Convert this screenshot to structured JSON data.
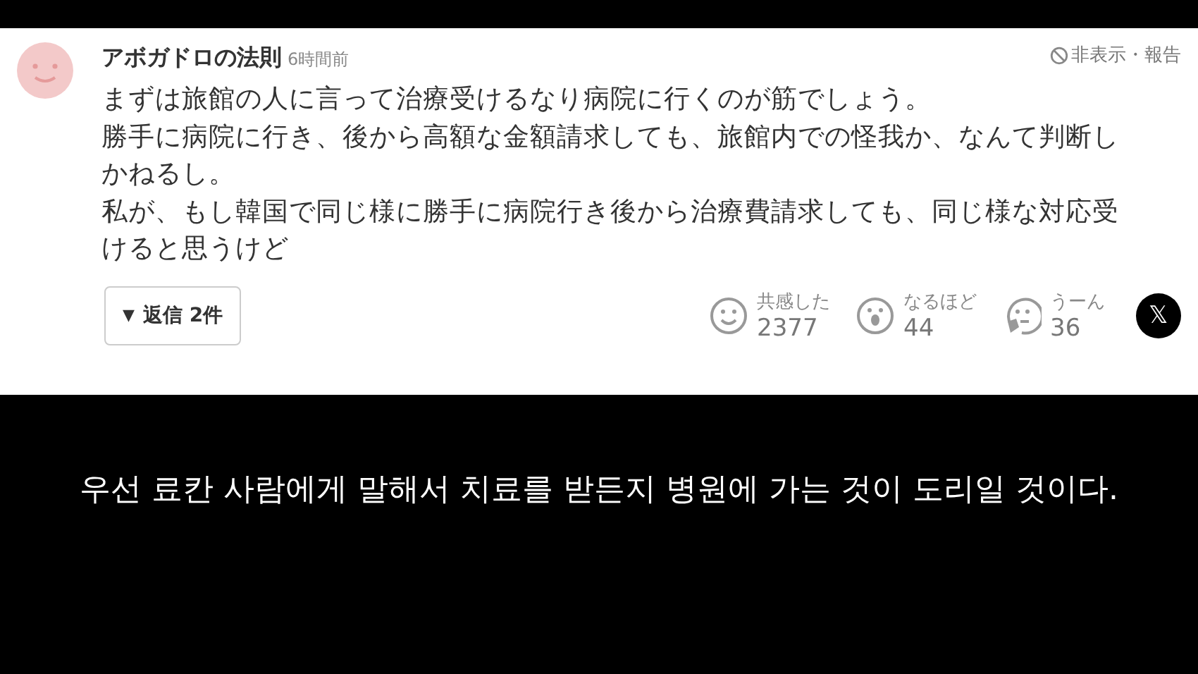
{
  "comment": {
    "author": "アボガドロの法則",
    "time": "6時間前",
    "hide_report": "非表示・報告",
    "paragraphs": [
      "まずは旅館の人に言って治療受けるなり病院に行くのが筋でしょう。",
      "勝手に病院に行き、後から高額な金額請求しても、旅館内での怪我か、なんて判断しかねるし。",
      "私が、もし韓国で同じ様に勝手に病院行き後から治療費請求しても、同じ様な対応受けると思うけど"
    ],
    "replies_button": {
      "arrow": "▼",
      "label": "返信 2件"
    },
    "reactions": [
      {
        "kind": "smile",
        "label": "共感した",
        "count": "2377"
      },
      {
        "kind": "surprise",
        "label": "なるほど",
        "count": "44"
      },
      {
        "kind": "think",
        "label": "うーん",
        "count": "36"
      }
    ],
    "share": {
      "label": "𝕏"
    }
  },
  "subtitle": "우선 료칸 사람에게 말해서 치료를 받든지 병원에 가는 것이 도리일 것이다."
}
